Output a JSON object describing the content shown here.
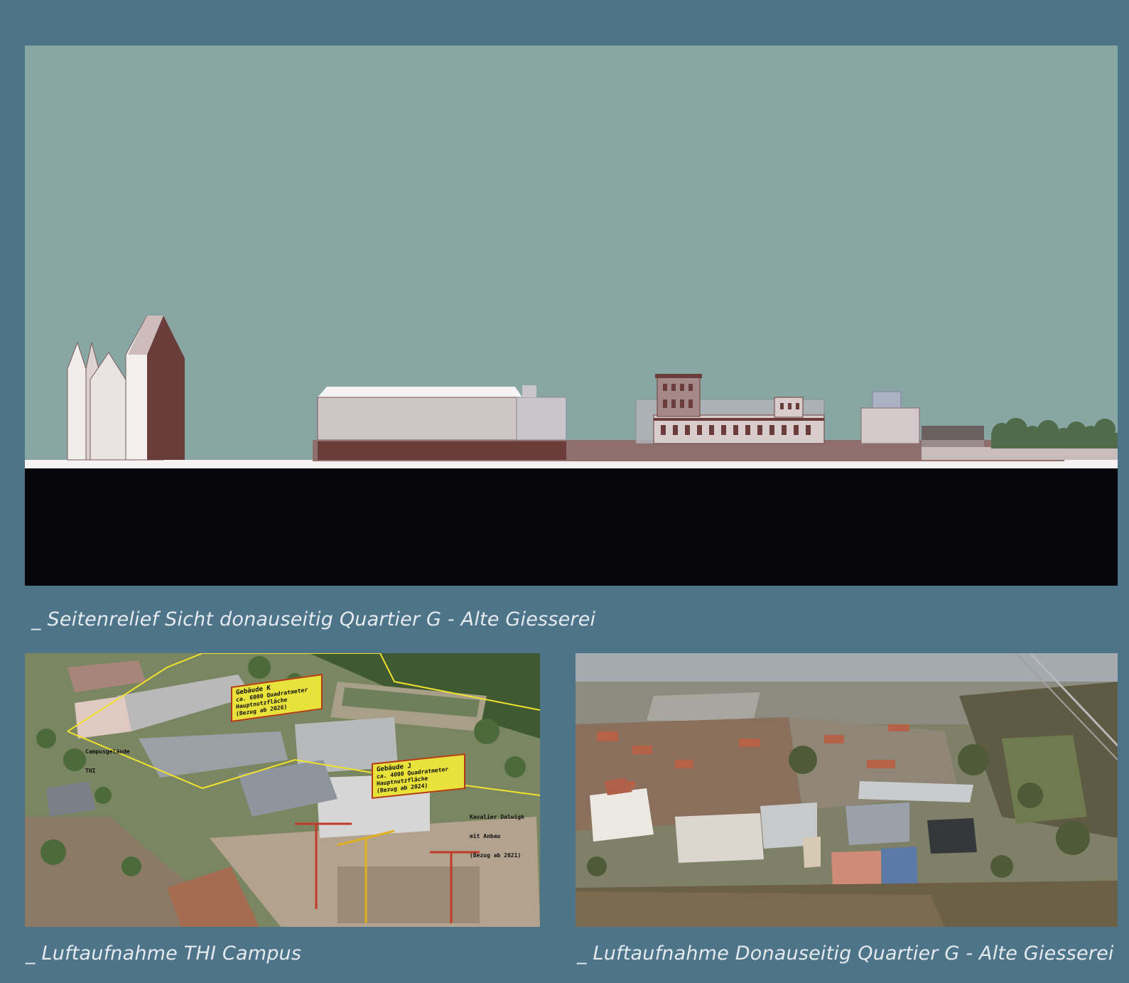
{
  "captions": {
    "elevation": "_ Seitenrelief Sicht donauseitig Quartier G - Alte Giesserei",
    "thi_campus": "_ Luftaufnahme THI Campus",
    "donau_side": "_ Luftaufnahme Donauseitig Quartier G - Alte Giesserei"
  },
  "thi_annotations": {
    "building_k": {
      "name": "Gebäude K",
      "area": "ca. 6000 Quadratmeter",
      "use": "Hauptnutzfläche",
      "move_in": "(Bezug ab 2026)"
    },
    "building_j": {
      "name": "Gebäude J",
      "area": "ca. 4000 Quadratmeter",
      "use": "Hauptnutzfläche",
      "move_in": "(Bezug ab 2024)"
    },
    "campus": {
      "line1": "Campusgelände",
      "line2": "THI"
    },
    "kavalier": {
      "line1": "Kavalier Dalwigk",
      "line2": "mit Anbau",
      "line3": "(Bezug ab 2021)"
    }
  },
  "colors": {
    "background": "#4e7489",
    "sky": "#87a6a4",
    "ground": "#05050a",
    "building_dark": "#6b3d3a",
    "building_light": "#cfc6c6"
  }
}
